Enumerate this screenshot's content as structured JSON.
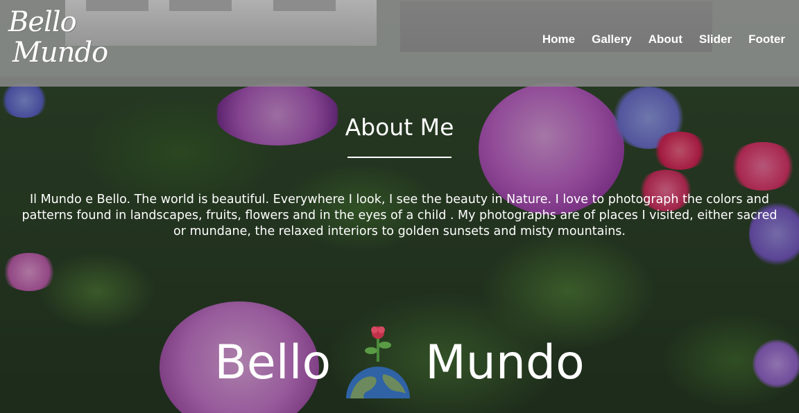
{
  "header": {
    "logo_line1": "Bello",
    "logo_line2": "Mundo",
    "nav": [
      "Home",
      "Gallery",
      "About",
      "Slider",
      "Footer"
    ]
  },
  "about": {
    "title": "About Me",
    "text": "Il Mundo e Bello. The world is beautiful. Everywhere I look, I see the beauty in Nature. I love to photograph the colors and patterns found in landscapes, fruits, flowers and in the eyes of a child . My photographs are of places I visited, either sacred or mundane, the relaxed interiors to golden sunsets and misty mountains."
  },
  "brand": {
    "left": "Bello",
    "right": "Mundo",
    "icon": "globe-with-flower-icon"
  },
  "colors": {
    "header_bg": "#969696",
    "text": "#ffffff",
    "globe_water": "#2f63a6",
    "globe_land": "#6c8a5d",
    "flower": "#c0324a"
  }
}
